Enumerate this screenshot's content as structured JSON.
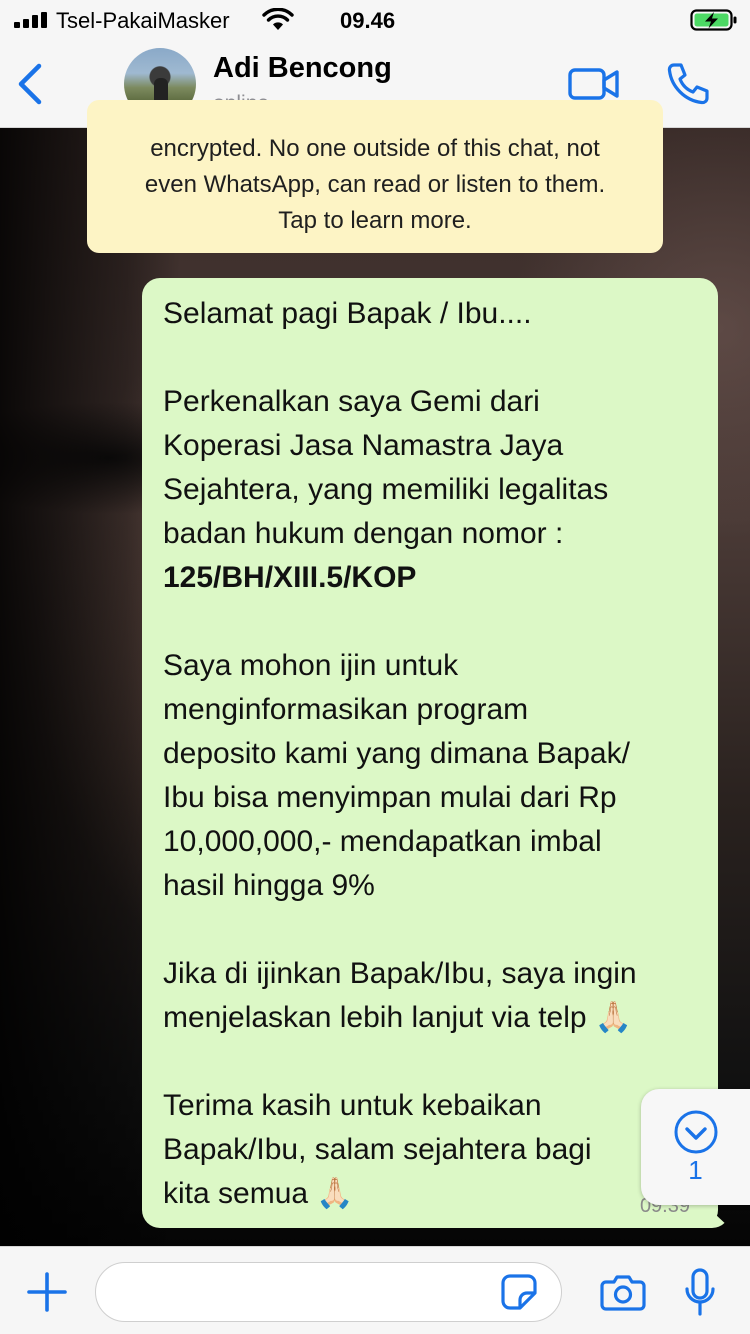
{
  "status_bar": {
    "carrier": "Tsel-PakaiMasker",
    "time": "09.46"
  },
  "header": {
    "contact_name": "Adi Bencong",
    "contact_status": "online"
  },
  "encryption_notice": {
    "lines": [
      "encrypted. No one outside of this chat, not",
      "even WhatsApp, can read or listen to them.",
      "Tap to learn more."
    ]
  },
  "message": {
    "lines": [
      "Selamat pagi Bapak / Ibu....",
      "",
      "Perkenalkan saya Gemi dari",
      "Koperasi Jasa Namastra Jaya",
      "Sejahtera, yang memiliki legalitas",
      "badan hukum dengan nomor :",
      "125/BH/XIII.5/KOP",
      "",
      "Saya mohon ijin untuk",
      "menginformasikan program",
      "deposito kami yang dimana Bapak/",
      "Ibu bisa menyimpan mulai dari Rp",
      "10,000,000,- mendapatkan imbal",
      "hasil hingga 9%",
      "",
      "Jika di ijinkan Bapak/Ibu, saya ingin",
      "menjelaskan lebih lanjut via telp 🙏🏻",
      "",
      "Terima kasih untuk kebaikan",
      "Bapak/Ibu, salam sejahtera bagi",
      "kita semua 🙏🏻"
    ],
    "bold_line_index": 6,
    "timestamp": "09.39"
  },
  "scroll_down": {
    "unread_count": "1"
  },
  "input_bar": {
    "message_value": ""
  },
  "colors": {
    "accent": "#1a73e8",
    "bubble": "#dcf8c6",
    "notice": "#fdf4c5"
  }
}
